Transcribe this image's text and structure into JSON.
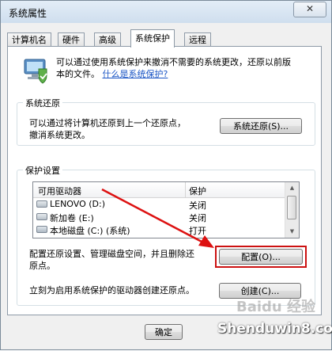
{
  "window": {
    "title": "系统属性",
    "close_glyph": "✕"
  },
  "tabs": [
    {
      "label": "计算机名",
      "active": false
    },
    {
      "label": "硬件",
      "active": false
    },
    {
      "label": "高级",
      "active": false
    },
    {
      "label": "系统保护",
      "active": true
    },
    {
      "label": "远程",
      "active": false
    }
  ],
  "intro": {
    "icon": "system-protection-icon",
    "text_line1": "可以通过使用系统保护来撤消不需要的系统更改，还原以前版",
    "text_line2_prefix": "本的文件。",
    "help_link": "什么是系统保护?"
  },
  "system_restore": {
    "group_label": "系统还原",
    "description_line1": "可以通过将计算机还原到上一个还原点，",
    "description_line2": "撤消系统更改。",
    "button_label": "系统还原(S)..."
  },
  "protection_settings": {
    "group_label": "保护设置",
    "columns": [
      "可用驱动器",
      "保护"
    ],
    "drives": [
      {
        "name": "LENOVO (D:)",
        "status": "关闭",
        "icon": "drive-icon"
      },
      {
        "name": "新加卷 (E:)",
        "status": "关闭",
        "icon": "drive-icon"
      },
      {
        "name": "本地磁盘 (C:) (系统)",
        "status": "打开",
        "icon": "system-drive-icon"
      }
    ],
    "configure_text_line1": "配置还原设置、管理磁盘空间，并且删除还",
    "configure_text_line2": "原点。",
    "configure_button": "配置(O)...",
    "create_text": "立刻为启用系统保护的驱动器创建还原点。",
    "create_button": "创建(C)..."
  },
  "footer": {
    "ok_button": "确定"
  },
  "watermark": {
    "baidu": "Baidu",
    "jingyan": "经验",
    "site": "Shenduwin8.com"
  },
  "colors": {
    "link": "#1a55c5",
    "highlight": "#cc1111",
    "arrow": "#dd1111"
  }
}
